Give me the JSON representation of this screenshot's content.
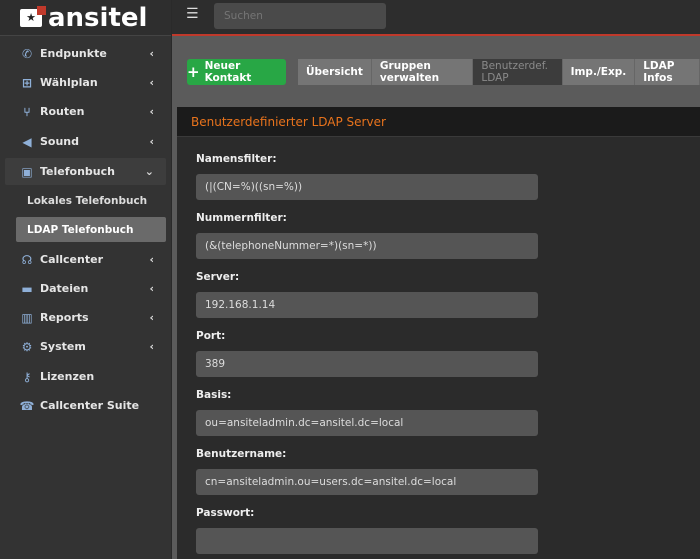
{
  "brand": {
    "name": "ansitel"
  },
  "topbar": {
    "menu_icon": "hamburger-icon",
    "search_placeholder": "Suchen"
  },
  "sidebar": {
    "items": [
      {
        "label": "Endpunkte",
        "icon": "phone-icon"
      },
      {
        "label": "Wählplan",
        "icon": "sitemap-icon"
      },
      {
        "label": "Routen",
        "icon": "fork-icon"
      },
      {
        "label": "Sound",
        "icon": "volume-icon"
      },
      {
        "label": "Telefonbuch",
        "icon": "address-book-icon",
        "open": true
      },
      {
        "label": "Callcenter",
        "icon": "headset-icon"
      },
      {
        "label": "Dateien",
        "icon": "folder-open-icon"
      },
      {
        "label": "Reports",
        "icon": "bar-chart-icon"
      },
      {
        "label": "System",
        "icon": "cogs-icon"
      },
      {
        "label": "Lizenzen",
        "icon": "key-icon"
      },
      {
        "label": "Callcenter Suite",
        "icon": "callcenter-suite-icon"
      }
    ],
    "subitems": [
      {
        "label": "Lokales Telefonbuch"
      },
      {
        "label": "LDAP Telefonbuch",
        "active": true
      }
    ]
  },
  "toolbar": {
    "new_contact": "Neuer Kontakt",
    "tabs": [
      {
        "label": "Übersicht"
      },
      {
        "label": "Gruppen verwalten"
      },
      {
        "label": "Benutzerdef. LDAP",
        "active": true
      },
      {
        "label": "Imp./Exp."
      },
      {
        "label": "LDAP Infos"
      }
    ]
  },
  "panel": {
    "title": "Benutzerdefinierter LDAP Server",
    "fields": [
      {
        "label": "Namensfilter:",
        "value": "(|(CN=%)((sn=%))"
      },
      {
        "label": "Nummernfilter:",
        "value": "(&(telephoneNummer=*)(sn=*))"
      },
      {
        "label": "Server:",
        "value": "192.168.1.14"
      },
      {
        "label": "Port:",
        "value": "389"
      },
      {
        "label": "Basis:",
        "value": "ou=ansiteladmin.dc=ansitel.dc=local"
      },
      {
        "label": "Benutzername:",
        "value": "cn=ansiteladmin.ou=users.dc=ansitel.dc=local"
      },
      {
        "label": "Passwort:",
        "value": ""
      }
    ]
  },
  "colors": {
    "accent": "#e8731c",
    "success": "#28a745",
    "topline": "#c0392b"
  }
}
